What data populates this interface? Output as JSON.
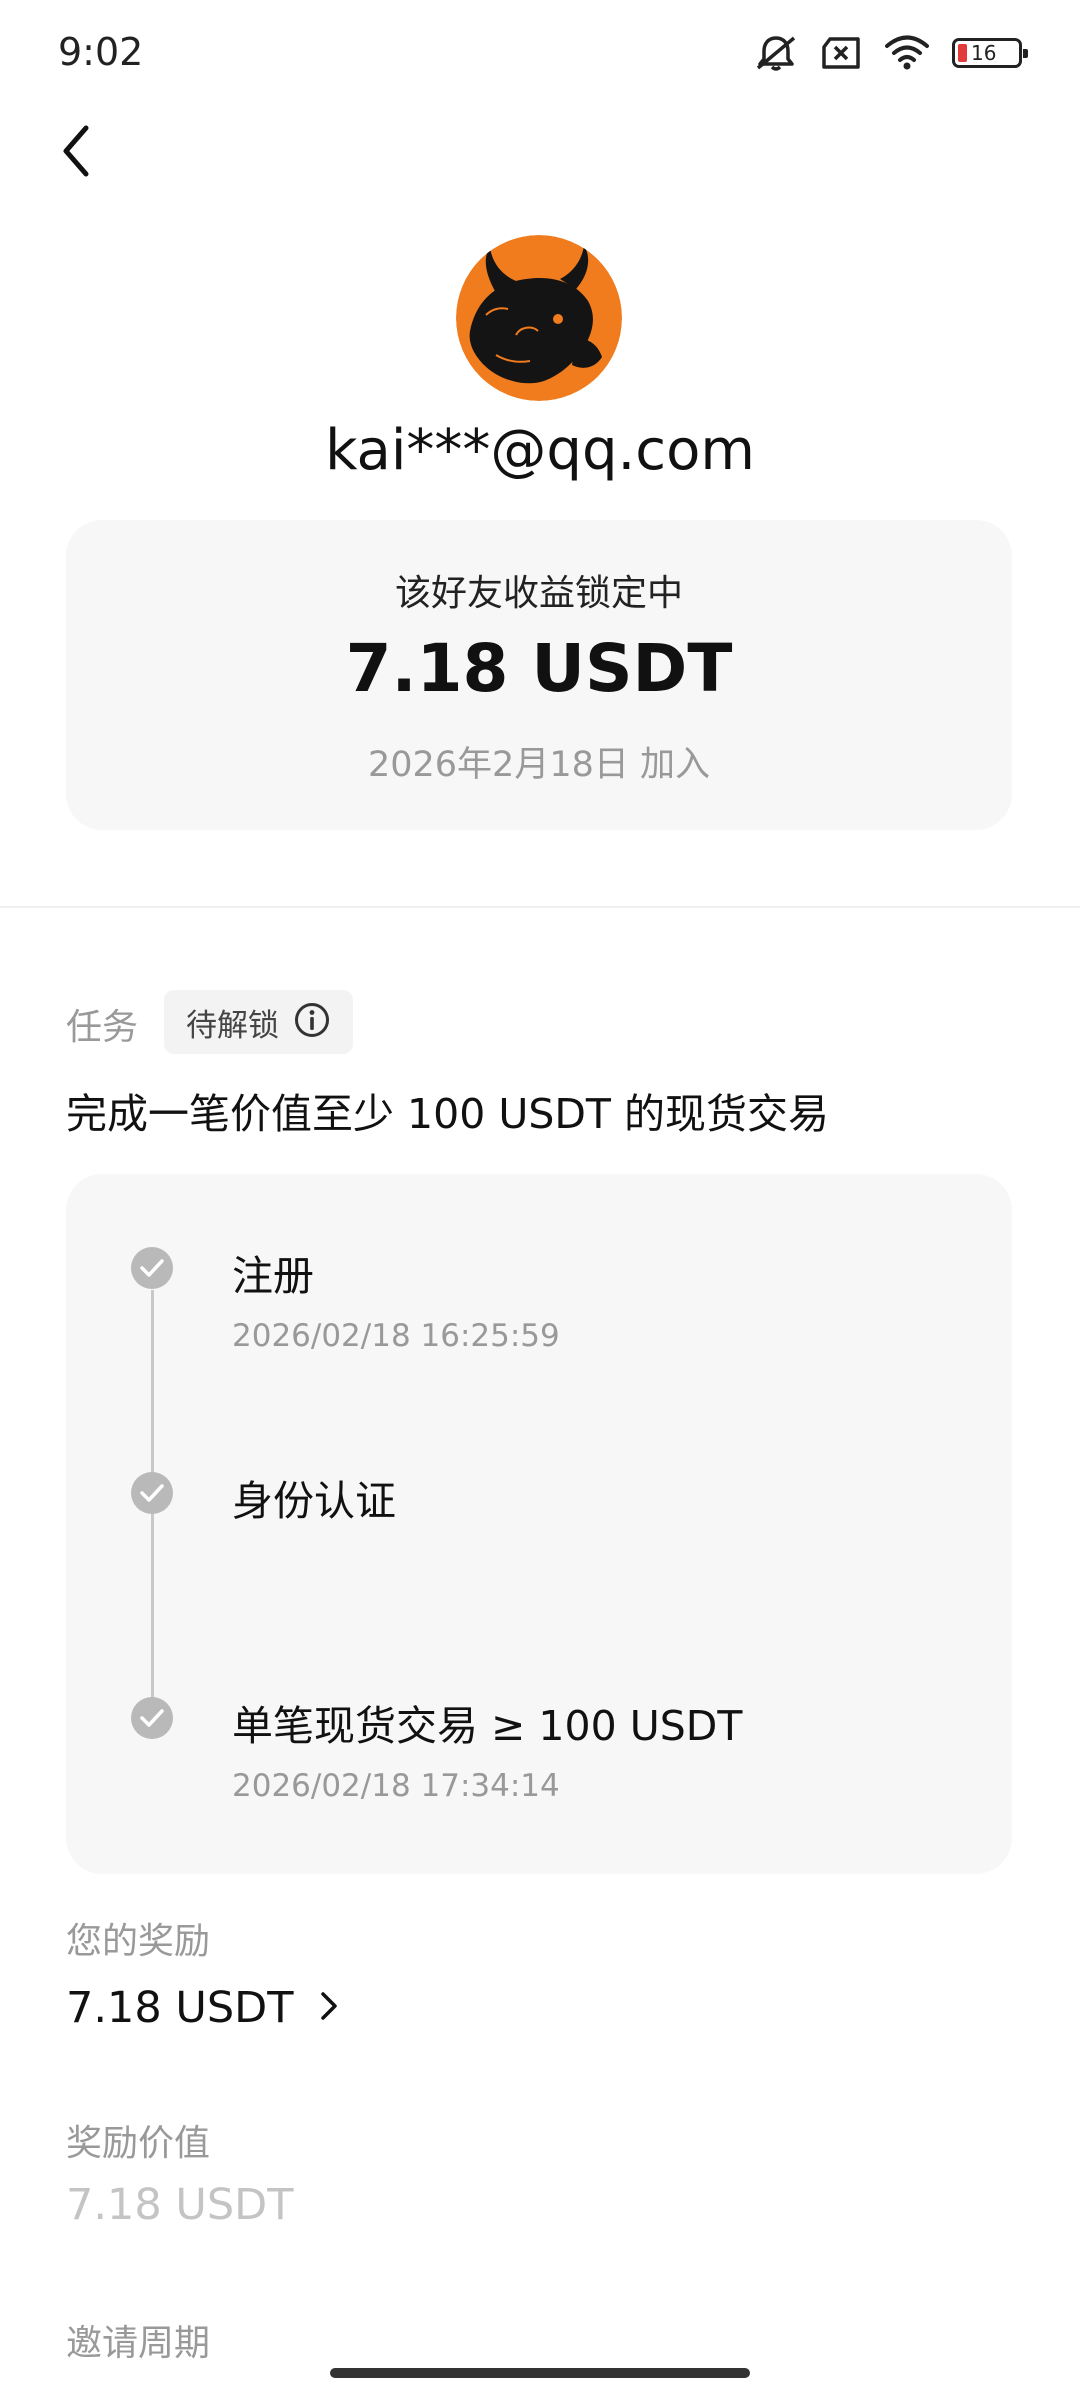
{
  "status_bar": {
    "time": "9:02",
    "battery_level": "16",
    "icons": [
      "mute-icon",
      "no-sim-icon",
      "wifi-icon",
      "battery-icon"
    ]
  },
  "header": {
    "back_icon": "chevron-left-icon"
  },
  "profile": {
    "email": "kai***@qq.com",
    "avatar_colors": {
      "background": "#f07c1e",
      "figure": "#141414"
    }
  },
  "summary": {
    "label": "该好友收益锁定中",
    "amount": "7.18 USDT",
    "joined": "2026年2月18日 加入"
  },
  "task": {
    "label": "任务",
    "status_badge": "待解锁",
    "info_icon": "info-icon",
    "description": "完成一笔价值至少 100 USDT 的现货交易",
    "steps": [
      {
        "title": "注册",
        "time": "2026/02/18 16:25:59",
        "done": true
      },
      {
        "title": "身份认证",
        "time": "",
        "done": true
      },
      {
        "title": "单笔现货交易 ≥ 100 USDT",
        "time": "2026/02/18 17:34:14",
        "done": true
      }
    ]
  },
  "reward": {
    "label": "您的奖励",
    "value": "7.18 USDT"
  },
  "reward_value": {
    "label": "奖励价值",
    "value": "7.18 USDT"
  },
  "invite_period": {
    "label": "邀请周期"
  },
  "colors": {
    "text_primary": "#111111",
    "text_secondary": "#999999",
    "card_bg": "#f7f7f7",
    "check_gray": "#b9b9b9",
    "battery_low": "#e23b3b"
  }
}
